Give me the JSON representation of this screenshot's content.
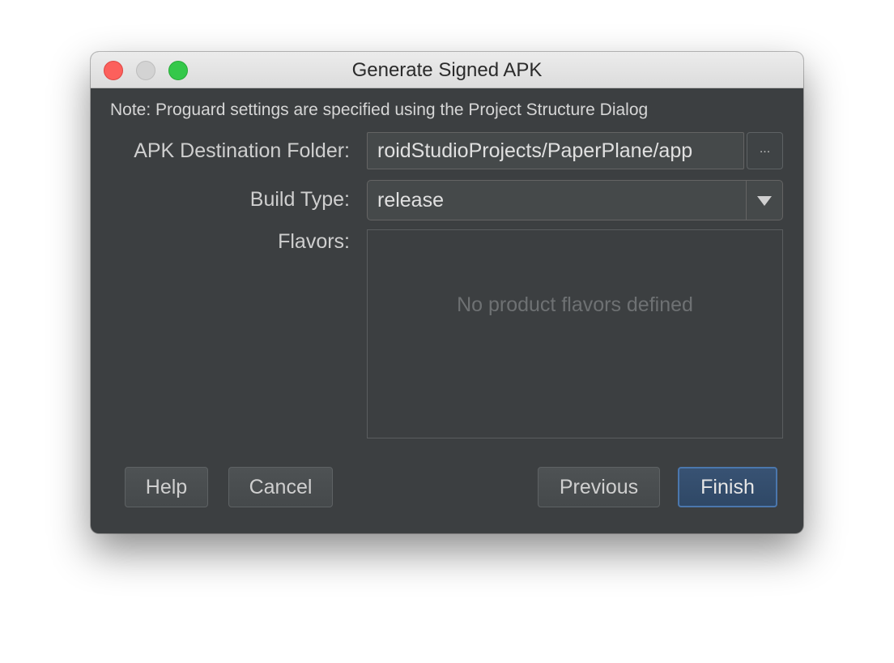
{
  "window": {
    "title": "Generate Signed APK"
  },
  "note": "Note: Proguard settings are specified using the Project Structure Dialog",
  "form": {
    "destination_label": "APK Destination Folder:",
    "destination_value": "roidStudioProjects/PaperPlane/app",
    "browse_label": "...",
    "build_type_label": "Build Type:",
    "build_type_value": "release",
    "flavors_label": "Flavors:",
    "flavors_empty": "No product flavors defined"
  },
  "buttons": {
    "help": "Help",
    "cancel": "Cancel",
    "previous": "Previous",
    "finish": "Finish"
  }
}
